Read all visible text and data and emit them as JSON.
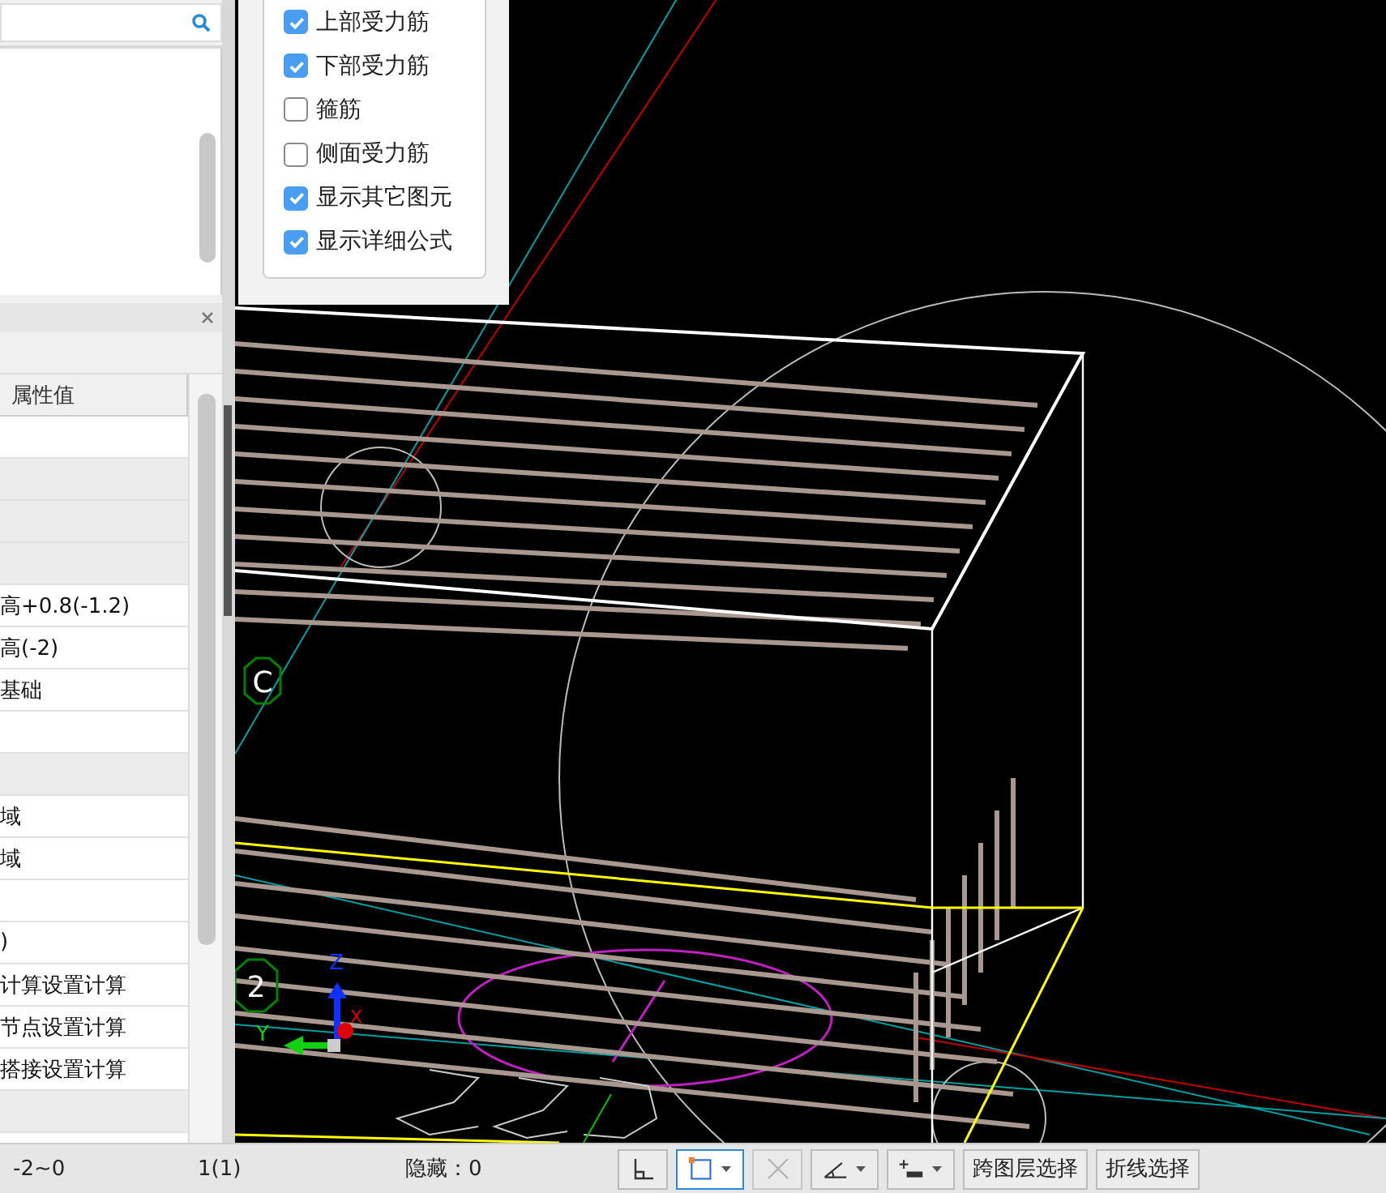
{
  "checkboxes": [
    {
      "label": "上部受力筋",
      "checked": true
    },
    {
      "label": "下部受力筋",
      "checked": true
    },
    {
      "label": "箍筋",
      "checked": false
    },
    {
      "label": "侧面受力筋",
      "checked": false
    },
    {
      "label": "显示其它图元",
      "checked": true
    },
    {
      "label": "显示详细公式",
      "checked": true
    }
  ],
  "properties": {
    "column_header": "属性值",
    "rows": [
      {
        "kind": "value"
      },
      {
        "kind": "group"
      },
      {
        "kind": "group"
      },
      {
        "kind": "group"
      },
      {
        "kind": "value",
        "value": "高+0.8(-1.2)"
      },
      {
        "kind": "value",
        "value": "高(-2)"
      },
      {
        "kind": "value",
        "value": "基础"
      },
      {
        "kind": "value"
      },
      {
        "kind": "group"
      },
      {
        "kind": "value",
        "value": "域"
      },
      {
        "kind": "value",
        "value": "域"
      },
      {
        "kind": "value"
      },
      {
        "kind": "value",
        "value": ")"
      },
      {
        "kind": "value",
        "value": "计算设置计算"
      },
      {
        "kind": "value",
        "value": "节点设置计算"
      },
      {
        "kind": "value",
        "value": "搭接设置计算"
      },
      {
        "kind": "group"
      }
    ]
  },
  "viewport": {
    "axis_labels": [
      "C",
      "2"
    ],
    "gizmo_labels": [
      "Z",
      "Y",
      "X"
    ]
  },
  "status_bar": {
    "texts": [
      "-2~0",
      "1(1)",
      "隐藏：0"
    ],
    "tools": [
      {
        "kind": "corner",
        "selected": false
      },
      {
        "kind": "select-box",
        "selected": true
      },
      {
        "kind": "cross",
        "selected": false
      },
      {
        "kind": "angle",
        "selected": false
      },
      {
        "kind": "plus-line",
        "selected": false
      },
      {
        "kind": "text",
        "label": "跨图层选择",
        "selected": false
      },
      {
        "kind": "text",
        "label": "折线选择",
        "selected": false
      }
    ]
  }
}
